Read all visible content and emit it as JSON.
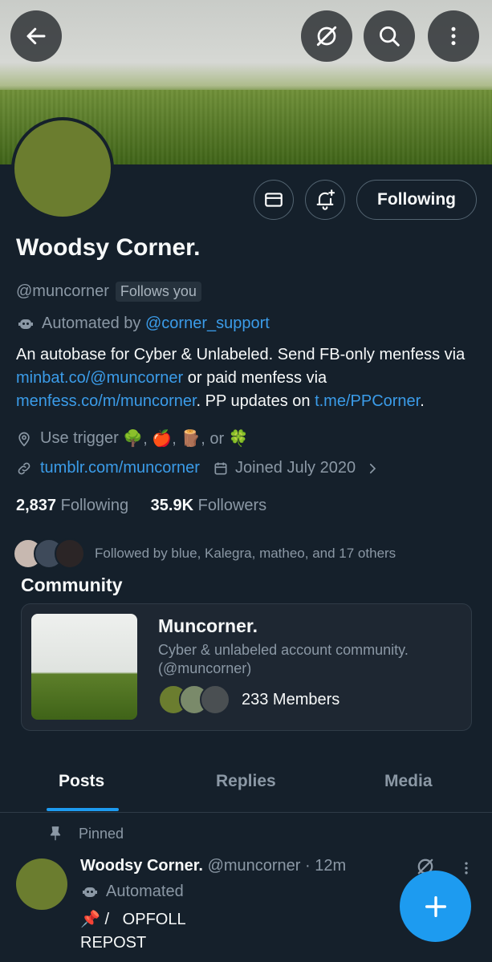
{
  "banner": {
    "description_icon": "banner-image"
  },
  "header": {
    "back_icon": "arrow-left-icon",
    "grok_icon": "grok-icon",
    "search_icon": "search-icon",
    "more_icon": "more-vertical-icon"
  },
  "profile_actions": {
    "message_icon": "mail-icon",
    "notify_icon": "bell-plus-icon",
    "follow_label": "Following"
  },
  "profile": {
    "name": "Woodsy Corner.",
    "handle": "@muncorner",
    "follows_you": "Follows you",
    "automated_prefix": "Automated by",
    "automated_by": "@corner_support",
    "bio": {
      "p1": "An autobase for Cyber & Unlabeled. Send FB-only menfess via ",
      "link1": "minbat.co/@muncorner",
      "p2": " or paid menfess via ",
      "link2": "menfess.co/m/muncorner",
      "p3": ". PP updates on ",
      "link3": "t.me/PPCorner",
      "p4": "."
    },
    "location_prefix": "Use trigger",
    "location_emojis": "🌳, 🍎, 🪵, or 🍀",
    "website": "tumblr.com/muncorner",
    "joined": "Joined July 2020",
    "following_count": "2,837",
    "following_label": "Following",
    "followers_count": "35.9K",
    "followers_label": "Followers",
    "followed_by": "Followed by blue, Kalegra, matheo, and 17 others"
  },
  "community": {
    "section_title": "Community",
    "name": "Muncorner.",
    "description": "Cyber & unlabeled account community.",
    "handle": "(@muncorner)",
    "members": "233 Members"
  },
  "tabs": [
    {
      "label": "Posts",
      "active": true
    },
    {
      "label": "Replies",
      "active": false
    },
    {
      "label": "Media",
      "active": false
    }
  ],
  "post": {
    "pinned_label": "Pinned",
    "author": "Woodsy Corner.",
    "meta": "@muncorner · 12m",
    "automated_label": "Automated",
    "line1": "📌 /   OPFOLL",
    "line2": "REPOST"
  },
  "fab": {
    "icon": "plus-icon"
  },
  "colors": {
    "background": "#15202b",
    "accent": "#1d9bf0",
    "link": "#3b9ce9",
    "muted": "#8b98a5",
    "avatar": "#6b7d2f"
  }
}
